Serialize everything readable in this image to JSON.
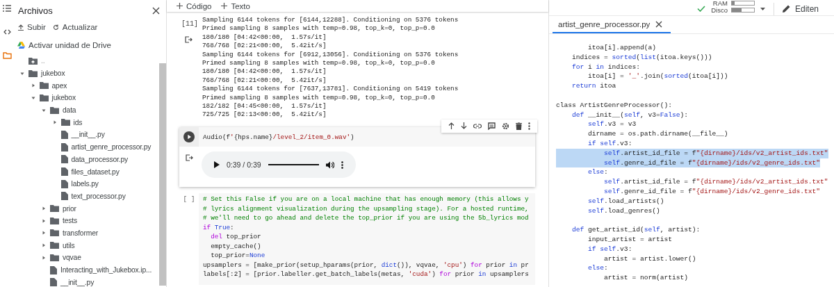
{
  "sidebar": {
    "title": "Archivos",
    "actions": [
      {
        "kind": "upload",
        "label": "Subir"
      },
      {
        "kind": "refresh",
        "label": "Actualizar"
      }
    ],
    "drive_link": "Activar unidad de Drive",
    "tree": [
      {
        "kind": "parent",
        "name": ".."
      },
      {
        "kind": "folder",
        "name": "jukebox",
        "expanded": true,
        "children": [
          {
            "kind": "folder",
            "name": "apex",
            "expanded": false
          },
          {
            "kind": "folder",
            "name": "jukebox",
            "expanded": true,
            "children": [
              {
                "kind": "folder",
                "name": "data",
                "expanded": true,
                "children": [
                  {
                    "kind": "folder",
                    "name": "ids",
                    "expanded": false
                  },
                  {
                    "kind": "file",
                    "name": "__init__.py"
                  },
                  {
                    "kind": "file",
                    "name": "artist_genre_processor.py"
                  },
                  {
                    "kind": "file",
                    "name": "data_processor.py"
                  },
                  {
                    "kind": "file",
                    "name": "files_dataset.py"
                  },
                  {
                    "kind": "file",
                    "name": "labels.py"
                  },
                  {
                    "kind": "file",
                    "name": "text_processor.py"
                  }
                ]
              },
              {
                "kind": "folder",
                "name": "prior",
                "expanded": false
              },
              {
                "kind": "folder",
                "name": "tests",
                "expanded": false
              },
              {
                "kind": "folder",
                "name": "transformer",
                "expanded": false
              },
              {
                "kind": "folder",
                "name": "utils",
                "expanded": false
              },
              {
                "kind": "folder",
                "name": "vqvae",
                "expanded": false
              },
              {
                "kind": "file",
                "name": "Interacting_with_Jukebox.ip..."
              },
              {
                "kind": "file",
                "name": "__init__.py"
              }
            ]
          }
        ]
      }
    ]
  },
  "toolbar": {
    "buttons": [
      "Código",
      "Texto"
    ]
  },
  "cells": [
    {
      "kind": "output",
      "execution_count": "[11]",
      "output_lines": [
        "Sampling 6144 tokens for [6144,12288]. Conditioning on 5376 tokens",
        "Primed sampling 8 samples with temp=0.98, top_k=0, top_p=0.0",
        "180/180 [04:42<00:00,  1.57s/it]",
        "768/768 [02:21<00:00,  5.42it/s]",
        "Sampling 6144 tokens for [6912,13056]. Conditioning on 5376 tokens",
        "Primed sampling 8 samples with temp=0.98, top_k=0, top_p=0.0",
        "180/180 [04:42<00:00,  1.57s/it]",
        "768/768 [02:21<00:00,  5.42it/s]",
        "Sampling 6144 tokens for [7637,13781]. Conditioning on 5419 tokens",
        "Primed sampling 8 samples with temp=0.98, top_k=0, top_p=0.0",
        "182/182 [04:45<00:00,  1.57s/it]",
        "725/725 [02:13<00:00,  5.42it/s]"
      ]
    },
    {
      "kind": "audio",
      "focused": true,
      "code": [
        [
          {
            "kind": "plain",
            "text": "Audio(f"
          },
          {
            "kind": "string",
            "text": "'"
          },
          {
            "kind": "plain",
            "text": "{hps.name}"
          },
          {
            "kind": "string",
            "text": "/level_2/item_0.wav'"
          },
          {
            "kind": "plain",
            "text": ")"
          }
        ]
      ],
      "player": {
        "time": "0:39 / 0:39",
        "level": 1
      }
    },
    {
      "kind": "code",
      "focused": false,
      "execution_count": "[ ]",
      "code": [
        [
          {
            "kind": "comment",
            "text": "# Set this False if you are on a local machine that has enough memory (this allows y"
          }
        ],
        [
          {
            "kind": "comment",
            "text": "# lyrics alignment visualization during the upsampling stage). For a hosted runtime,"
          }
        ],
        [
          {
            "kind": "comment",
            "text": "# we'll need to go ahead and delete the top_prior if you are using the 5b_lyrics mod"
          }
        ],
        [
          {
            "kind": "keyword",
            "text": "if"
          },
          {
            "kind": "builtin",
            "text": " True"
          },
          {
            "kind": "plain",
            "text": ":"
          }
        ],
        [
          {
            "kind": "keyword",
            "text": "  del"
          },
          {
            "kind": "plain",
            "text": " top_prior"
          }
        ],
        [
          {
            "kind": "plain",
            "text": "  empty_cache()"
          }
        ],
        [
          {
            "kind": "plain",
            "text": "  top_prior="
          },
          {
            "kind": "builtin",
            "text": "None"
          }
        ],
        [
          {
            "kind": "plain",
            "text": "upsamplers = [make_prior(setup_hparams(prior, "
          },
          {
            "kind": "builtin",
            "text": "dict"
          },
          {
            "kind": "plain",
            "text": "()), vqvae, "
          },
          {
            "kind": "string",
            "text": "'cpu'"
          },
          {
            "kind": "plain",
            "text": ") "
          },
          {
            "kind": "keyword",
            "text": "for"
          },
          {
            "kind": "plain",
            "text": " prior "
          },
          {
            "kind": "builtin",
            "text": "in"
          },
          {
            "kind": "plain",
            "text": " pr"
          }
        ],
        [
          {
            "kind": "plain",
            "text": "labels[:2] = [prior.labeller.get_batch_labels(metas, "
          },
          {
            "kind": "string",
            "text": "'cuda'"
          },
          {
            "kind": "plain",
            "text": ") "
          },
          {
            "kind": "keyword",
            "text": "for"
          },
          {
            "kind": "plain",
            "text": " prior "
          },
          {
            "kind": "builtin",
            "text": "in"
          },
          {
            "kind": "plain",
            "text": " upsamplers"
          }
        ]
      ]
    }
  ],
  "runtime": {
    "connected": true,
    "meters": [
      {
        "label": "RAM",
        "level": 0.12
      },
      {
        "label": "Disco",
        "level": 0.45
      }
    ],
    "edit_button": "Editen"
  },
  "editor": {
    "tabs": [
      {
        "label": "artist_genre_processor.py",
        "selected": true
      }
    ],
    "lines": [
      {
        "selected": false,
        "tokens": [
          {
            "kind": "plain",
            "text": "        itoa[i].append(a)"
          }
        ]
      },
      {
        "selected": false,
        "tokens": [
          {
            "kind": "plain",
            "text": "    indices = "
          },
          {
            "kind": "builtin",
            "text": "sorted"
          },
          {
            "kind": "plain",
            "text": "("
          },
          {
            "kind": "builtin",
            "text": "list"
          },
          {
            "kind": "plain",
            "text": "(itoa.keys()))"
          }
        ]
      },
      {
        "selected": false,
        "tokens": [
          {
            "kind": "builtin",
            "text": "    for"
          },
          {
            "kind": "plain",
            "text": " i "
          },
          {
            "kind": "builtin",
            "text": "in"
          },
          {
            "kind": "plain",
            "text": " indices:"
          }
        ]
      },
      {
        "selected": false,
        "tokens": [
          {
            "kind": "plain",
            "text": "        itoa[i] = "
          },
          {
            "kind": "string",
            "text": "'_'"
          },
          {
            "kind": "plain",
            "text": ".join("
          },
          {
            "kind": "builtin",
            "text": "sorted"
          },
          {
            "kind": "plain",
            "text": "(itoa[i]))"
          }
        ]
      },
      {
        "selected": false,
        "tokens": [
          {
            "kind": "builtin",
            "text": "    return"
          },
          {
            "kind": "plain",
            "text": " itoa"
          }
        ]
      },
      {
        "selected": false,
        "blank_before": true,
        "tokens": [
          {
            "kind": "plain",
            "text": "class ArtistGenreProcessor():"
          }
        ]
      },
      {
        "selected": false,
        "tokens": [
          {
            "kind": "builtin",
            "text": "    def"
          },
          {
            "kind": "plain",
            "text": " __init__("
          },
          {
            "kind": "builtin",
            "text": "self"
          },
          {
            "kind": "plain",
            "text": ", v3="
          },
          {
            "kind": "builtin",
            "text": "False"
          },
          {
            "kind": "plain",
            "text": "):"
          }
        ]
      },
      {
        "selected": false,
        "tokens": [
          {
            "kind": "builtin",
            "text": "        self"
          },
          {
            "kind": "plain",
            "text": ".v3 = v3"
          }
        ]
      },
      {
        "selected": false,
        "tokens": [
          {
            "kind": "plain",
            "text": "        dirname = os.path.dirname(__file__)"
          }
        ]
      },
      {
        "selected": false,
        "tokens": [
          {
            "kind": "builtin",
            "text": "        if self"
          },
          {
            "kind": "plain",
            "text": ".v3:"
          }
        ]
      },
      {
        "selected": true,
        "tokens": [
          {
            "kind": "builtin",
            "text": "            self"
          },
          {
            "kind": "plain",
            "text": ".artist_id_file = f"
          },
          {
            "kind": "string",
            "text": "\"{dirname}/ids/v2_artist_ids.txt\""
          }
        ]
      },
      {
        "selected": true,
        "tokens": [
          {
            "kind": "builtin",
            "text": "            self"
          },
          {
            "kind": "plain",
            "text": ".genre_id_file = f"
          },
          {
            "kind": "string",
            "text": "\"{dirname}/ids/v2_genre_ids.txt\""
          }
        ]
      },
      {
        "selected": false,
        "tokens": [
          {
            "kind": "builtin",
            "text": "        else"
          },
          {
            "kind": "plain",
            "text": ":"
          }
        ]
      },
      {
        "selected": false,
        "tokens": [
          {
            "kind": "builtin",
            "text": "            self"
          },
          {
            "kind": "plain",
            "text": ".artist_id_file = f"
          },
          {
            "kind": "string",
            "text": "\"{dirname}/ids/v2_artist_ids.txt\""
          }
        ]
      },
      {
        "selected": false,
        "tokens": [
          {
            "kind": "builtin",
            "text": "            self"
          },
          {
            "kind": "plain",
            "text": ".genre_id_file = f"
          },
          {
            "kind": "string",
            "text": "\"{dirname}/ids/v2_genre_ids.txt\""
          }
        ]
      },
      {
        "selected": false,
        "tokens": [
          {
            "kind": "builtin",
            "text": "        self"
          },
          {
            "kind": "plain",
            "text": ".load_artists()"
          }
        ]
      },
      {
        "selected": false,
        "tokens": [
          {
            "kind": "builtin",
            "text": "        self"
          },
          {
            "kind": "plain",
            "text": ".load_genres()"
          }
        ]
      },
      {
        "selected": false,
        "blank_before": true,
        "tokens": [
          {
            "kind": "builtin",
            "text": "    def"
          },
          {
            "kind": "plain",
            "text": " get_artist_id("
          },
          {
            "kind": "builtin",
            "text": "self"
          },
          {
            "kind": "plain",
            "text": ", artist):"
          }
        ]
      },
      {
        "selected": false,
        "tokens": [
          {
            "kind": "plain",
            "text": "        input_artist = artist"
          }
        ]
      },
      {
        "selected": false,
        "tokens": [
          {
            "kind": "builtin",
            "text": "        if self"
          },
          {
            "kind": "plain",
            "text": ".v3:"
          }
        ]
      },
      {
        "selected": false,
        "tokens": [
          {
            "kind": "plain",
            "text": "            artist = artist.lower()"
          }
        ]
      },
      {
        "selected": false,
        "tokens": [
          {
            "kind": "builtin",
            "text": "        else"
          },
          {
            "kind": "plain",
            "text": ":"
          }
        ]
      },
      {
        "selected": false,
        "tokens": [
          {
            "kind": "plain",
            "text": "            artist = norm(artist)"
          }
        ]
      }
    ]
  }
}
